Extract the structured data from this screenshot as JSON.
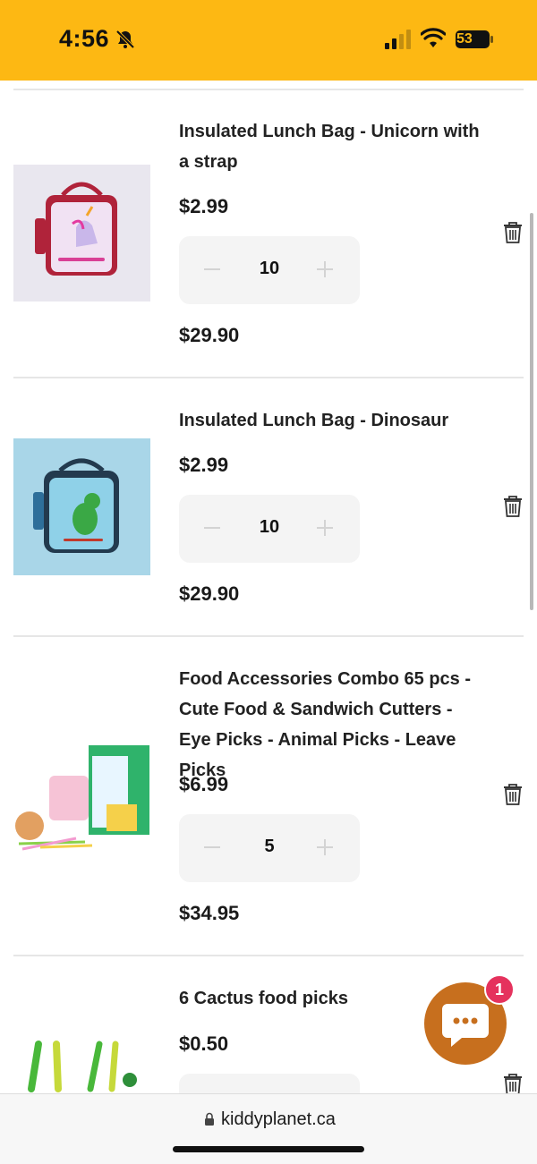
{
  "status_bar": {
    "time": "4:56",
    "battery_level": "53"
  },
  "cart": {
    "items": [
      {
        "title": "Insulated Lunch Bag - Unicorn with a strap",
        "unit_price": "$2.99",
        "quantity": "10",
        "line_total": "$29.90",
        "image": "unicorn-lunch-bag"
      },
      {
        "title": "Insulated Lunch Bag - Dinosaur",
        "unit_price": "$2.99",
        "quantity": "10",
        "line_total": "$29.90",
        "image": "dinosaur-lunch-bag"
      },
      {
        "title": "Food Accessories Combo 65 pcs - Cute Food & Sandwich Cutters - Eye Picks - Animal Picks - Leave Picks",
        "unit_price": "$6.99",
        "quantity": "5",
        "line_total": "$34.95",
        "image": "food-accessories-combo"
      },
      {
        "title": "6 Cactus food picks",
        "unit_price": "$0.50",
        "image": "cactus-food-picks"
      }
    ]
  },
  "chat_widget": {
    "badge_count": "1",
    "icon": "chat-bubble-icon"
  },
  "browser": {
    "url": "kiddyplanet.ca"
  },
  "colors": {
    "status_bar": "#fdb813",
    "chat_button": "#c76f1e",
    "badge": "#e5325d",
    "qty_bg": "#f4f4f4"
  }
}
